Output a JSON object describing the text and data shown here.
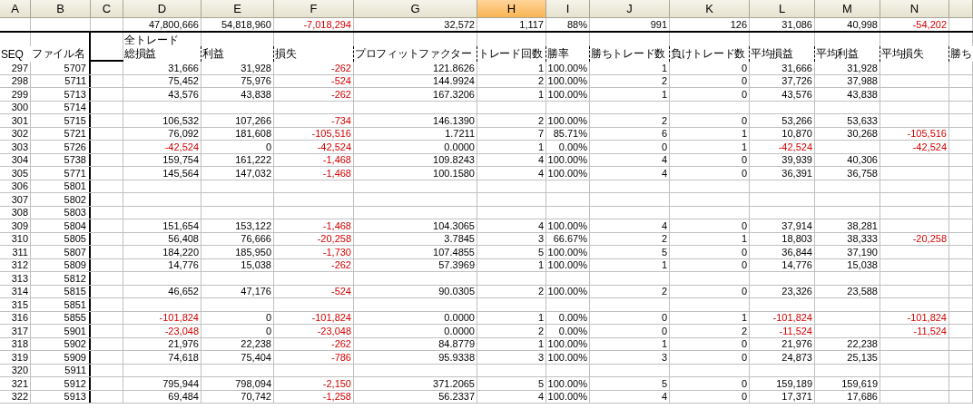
{
  "column_headers": [
    {
      "label": "A",
      "selected": false
    },
    {
      "label": "B",
      "selected": false
    },
    {
      "label": "C",
      "selected": false
    },
    {
      "label": "D",
      "selected": false
    },
    {
      "label": "E",
      "selected": false
    },
    {
      "label": "F",
      "selected": false
    },
    {
      "label": "G",
      "selected": false
    },
    {
      "label": "H",
      "selected": true
    },
    {
      "label": "I",
      "selected": false
    },
    {
      "label": "J",
      "selected": false
    },
    {
      "label": "K",
      "selected": false
    },
    {
      "label": "L",
      "selected": false
    },
    {
      "label": "M",
      "selected": false
    },
    {
      "label": "N",
      "selected": false
    }
  ],
  "totals": [
    {
      "text": "47,800,666",
      "negative": false
    },
    {
      "text": "54,818,960",
      "negative": false
    },
    {
      "text": "-7,018,294",
      "negative": true
    },
    {
      "text": "32,572",
      "negative": false
    },
    {
      "text": "1,117",
      "negative": false
    },
    {
      "text": "88%",
      "negative": false
    },
    {
      "text": "991",
      "negative": false
    },
    {
      "text": "126",
      "negative": false
    },
    {
      "text": "31,086",
      "negative": false
    },
    {
      "text": "40,998",
      "negative": false
    },
    {
      "text": "-54,202",
      "negative": true
    }
  ],
  "group_label": "全トレード",
  "key_headers": [
    "SEQ",
    "ファイル名"
  ],
  "metric_headers": [
    "総損益",
    "利益",
    "損失",
    "プロフィットファクター",
    "トレード回数",
    "勝率",
    "勝ちトレード数",
    "負けトレード数",
    "平均損益",
    "平均利益",
    "平均損失",
    "勝ち"
  ],
  "rows": [
    {
      "seq": "297",
      "file": "5707",
      "cells": [
        {
          "kind": "value",
          "text": "31,666",
          "negative": false
        },
        {
          "kind": "value",
          "text": "31,928",
          "negative": false
        },
        {
          "kind": "value",
          "text": "-262",
          "negative": true
        },
        {
          "kind": "value",
          "text": "121.8626",
          "negative": false
        },
        {
          "kind": "value",
          "text": "1",
          "negative": false
        },
        {
          "kind": "value",
          "text": "100.00%",
          "negative": false
        },
        {
          "kind": "value",
          "text": "1",
          "negative": false
        },
        {
          "kind": "value",
          "text": "0",
          "negative": false
        },
        {
          "kind": "value",
          "text": "31,666",
          "negative": false
        },
        {
          "kind": "value",
          "text": "31,928",
          "negative": false
        }
      ]
    },
    {
      "seq": "298",
      "file": "5711",
      "cells": [
        {
          "kind": "value",
          "text": "75,452",
          "negative": false
        },
        {
          "kind": "value",
          "text": "75,976",
          "negative": false
        },
        {
          "kind": "value",
          "text": "-524",
          "negative": true
        },
        {
          "kind": "value",
          "text": "144.9924",
          "negative": false
        },
        {
          "kind": "value",
          "text": "2",
          "negative": false
        },
        {
          "kind": "value",
          "text": "100.00%",
          "negative": false
        },
        {
          "kind": "value",
          "text": "2",
          "negative": false
        },
        {
          "kind": "value",
          "text": "0",
          "negative": false
        },
        {
          "kind": "value",
          "text": "37,726",
          "negative": false
        },
        {
          "kind": "value",
          "text": "37,988",
          "negative": false
        }
      ]
    },
    {
      "seq": "299",
      "file": "5713",
      "cells": [
        {
          "kind": "value",
          "text": "43,576",
          "negative": false
        },
        {
          "kind": "value",
          "text": "43,838",
          "negative": false
        },
        {
          "kind": "value",
          "text": "-262",
          "negative": true
        },
        {
          "kind": "value",
          "text": "167.3206",
          "negative": false
        },
        {
          "kind": "value",
          "text": "1",
          "negative": false
        },
        {
          "kind": "value",
          "text": "100.00%",
          "negative": false
        },
        {
          "kind": "value",
          "text": "1",
          "negative": false
        },
        {
          "kind": "value",
          "text": "0",
          "negative": false
        },
        {
          "kind": "value",
          "text": "43,576",
          "negative": false
        },
        {
          "kind": "value",
          "text": "43,838",
          "negative": false
        }
      ]
    },
    {
      "seq": "300",
      "file": "5714"
    },
    {
      "seq": "301",
      "file": "5715",
      "cells": [
        {
          "kind": "value",
          "text": "106,532",
          "negative": false
        },
        {
          "kind": "value",
          "text": "107,266",
          "negative": false
        },
        {
          "kind": "value",
          "text": "-734",
          "negative": true
        },
        {
          "kind": "value",
          "text": "146.1390",
          "negative": false
        },
        {
          "kind": "value",
          "text": "2",
          "negative": false
        },
        {
          "kind": "value",
          "text": "100.00%",
          "negative": false
        },
        {
          "kind": "value",
          "text": "2",
          "negative": false
        },
        {
          "kind": "value",
          "text": "0",
          "negative": false
        },
        {
          "kind": "value",
          "text": "53,266",
          "negative": false
        },
        {
          "kind": "value",
          "text": "53,633",
          "negative": false
        }
      ]
    },
    {
      "seq": "302",
      "file": "5721",
      "cells": [
        {
          "kind": "value",
          "text": "76,092",
          "negative": false
        },
        {
          "kind": "value",
          "text": "181,608",
          "negative": false
        },
        {
          "kind": "value",
          "text": "-105,516",
          "negative": true
        },
        {
          "kind": "value",
          "text": "1.7211",
          "negative": false
        },
        {
          "kind": "value",
          "text": "7",
          "negative": false
        },
        {
          "kind": "value",
          "text": "85.71%",
          "negative": false
        },
        {
          "kind": "value",
          "text": "6",
          "negative": false
        },
        {
          "kind": "value",
          "text": "1",
          "negative": false
        },
        {
          "kind": "value",
          "text": "10,870",
          "negative": false
        },
        {
          "kind": "value",
          "text": "30,268",
          "negative": false
        },
        {
          "kind": "value",
          "text": "-105,516",
          "negative": true
        }
      ]
    },
    {
      "seq": "303",
      "file": "5726",
      "cells": [
        {
          "kind": "value",
          "text": "-42,524",
          "negative": true
        },
        {
          "kind": "value",
          "text": "0",
          "negative": false
        },
        {
          "kind": "value",
          "text": "-42,524",
          "negative": true
        },
        {
          "kind": "value",
          "text": "0.0000",
          "negative": false
        },
        {
          "kind": "value",
          "text": "1",
          "negative": false
        },
        {
          "kind": "value",
          "text": "0.00%",
          "negative": false
        },
        {
          "kind": "value",
          "text": "0",
          "negative": false
        },
        {
          "kind": "value",
          "text": "1",
          "negative": false
        },
        {
          "kind": "value",
          "text": "-42,524",
          "negative": true
        },
        {
          "kind": "blank"
        },
        {
          "kind": "value",
          "text": "-42,524",
          "negative": true
        }
      ]
    },
    {
      "seq": "304",
      "file": "5738",
      "cells": [
        {
          "kind": "value",
          "text": "159,754",
          "negative": false
        },
        {
          "kind": "value",
          "text": "161,222",
          "negative": false
        },
        {
          "kind": "value",
          "text": "-1,468",
          "negative": true
        },
        {
          "kind": "value",
          "text": "109.8243",
          "negative": false
        },
        {
          "kind": "value",
          "text": "4",
          "negative": false
        },
        {
          "kind": "value",
          "text": "100.00%",
          "negative": false
        },
        {
          "kind": "value",
          "text": "4",
          "negative": false
        },
        {
          "kind": "value",
          "text": "0",
          "negative": false
        },
        {
          "kind": "value",
          "text": "39,939",
          "negative": false
        },
        {
          "kind": "value",
          "text": "40,306",
          "negative": false
        }
      ]
    },
    {
      "seq": "305",
      "file": "5771",
      "cells": [
        {
          "kind": "value",
          "text": "145,564",
          "negative": false
        },
        {
          "kind": "value",
          "text": "147,032",
          "negative": false
        },
        {
          "kind": "value",
          "text": "-1,468",
          "negative": true
        },
        {
          "kind": "value",
          "text": "100.1580",
          "negative": false
        },
        {
          "kind": "value",
          "text": "4",
          "negative": false
        },
        {
          "kind": "value",
          "text": "100.00%",
          "negative": false
        },
        {
          "kind": "value",
          "text": "4",
          "negative": false
        },
        {
          "kind": "value",
          "text": "0",
          "negative": false
        },
        {
          "kind": "value",
          "text": "36,391",
          "negative": false
        },
        {
          "kind": "value",
          "text": "36,758",
          "negative": false
        }
      ]
    },
    {
      "seq": "306",
      "file": "5801"
    },
    {
      "seq": "307",
      "file": "5802"
    },
    {
      "seq": "308",
      "file": "5803"
    },
    {
      "seq": "309",
      "file": "5804",
      "cells": [
        {
          "kind": "value",
          "text": "151,654",
          "negative": false
        },
        {
          "kind": "value",
          "text": "153,122",
          "negative": false
        },
        {
          "kind": "value",
          "text": "-1,468",
          "negative": true
        },
        {
          "kind": "value",
          "text": "104.3065",
          "negative": false
        },
        {
          "kind": "value",
          "text": "4",
          "negative": false
        },
        {
          "kind": "value",
          "text": "100.00%",
          "negative": false
        },
        {
          "kind": "value",
          "text": "4",
          "negative": false
        },
        {
          "kind": "value",
          "text": "0",
          "negative": false
        },
        {
          "kind": "value",
          "text": "37,914",
          "negative": false
        },
        {
          "kind": "value",
          "text": "38,281",
          "negative": false
        }
      ]
    },
    {
      "seq": "310",
      "file": "5805",
      "cells": [
        {
          "kind": "value",
          "text": "56,408",
          "negative": false
        },
        {
          "kind": "value",
          "text": "76,666",
          "negative": false
        },
        {
          "kind": "value",
          "text": "-20,258",
          "negative": true
        },
        {
          "kind": "value",
          "text": "3.7845",
          "negative": false
        },
        {
          "kind": "value",
          "text": "3",
          "negative": false
        },
        {
          "kind": "value",
          "text": "66.67%",
          "negative": false
        },
        {
          "kind": "value",
          "text": "2",
          "negative": false
        },
        {
          "kind": "value",
          "text": "1",
          "negative": false
        },
        {
          "kind": "value",
          "text": "18,803",
          "negative": false
        },
        {
          "kind": "value",
          "text": "38,333",
          "negative": false
        },
        {
          "kind": "value",
          "text": "-20,258",
          "negative": true
        }
      ]
    },
    {
      "seq": "311",
      "file": "5807",
      "cells": [
        {
          "kind": "value",
          "text": "184,220",
          "negative": false
        },
        {
          "kind": "value",
          "text": "185,950",
          "negative": false
        },
        {
          "kind": "value",
          "text": "-1,730",
          "negative": true
        },
        {
          "kind": "value",
          "text": "107.4855",
          "negative": false
        },
        {
          "kind": "value",
          "text": "5",
          "negative": false
        },
        {
          "kind": "value",
          "text": "100.00%",
          "negative": false
        },
        {
          "kind": "value",
          "text": "5",
          "negative": false
        },
        {
          "kind": "value",
          "text": "0",
          "negative": false
        },
        {
          "kind": "value",
          "text": "36,844",
          "negative": false
        },
        {
          "kind": "value",
          "text": "37,190",
          "negative": false
        }
      ]
    },
    {
      "seq": "312",
      "file": "5809",
      "cells": [
        {
          "kind": "value",
          "text": "14,776",
          "negative": false
        },
        {
          "kind": "value",
          "text": "15,038",
          "negative": false
        },
        {
          "kind": "value",
          "text": "-262",
          "negative": true
        },
        {
          "kind": "value",
          "text": "57.3969",
          "negative": false
        },
        {
          "kind": "value",
          "text": "1",
          "negative": false
        },
        {
          "kind": "value",
          "text": "100.00%",
          "negative": false
        },
        {
          "kind": "value",
          "text": "1",
          "negative": false
        },
        {
          "kind": "value",
          "text": "0",
          "negative": false
        },
        {
          "kind": "value",
          "text": "14,776",
          "negative": false
        },
        {
          "kind": "value",
          "text": "15,038",
          "negative": false
        }
      ]
    },
    {
      "seq": "313",
      "file": "5812"
    },
    {
      "seq": "314",
      "file": "5815",
      "cells": [
        {
          "kind": "value",
          "text": "46,652",
          "negative": false
        },
        {
          "kind": "value",
          "text": "47,176",
          "negative": false
        },
        {
          "kind": "value",
          "text": "-524",
          "negative": true
        },
        {
          "kind": "value",
          "text": "90.0305",
          "negative": false
        },
        {
          "kind": "value",
          "text": "2",
          "negative": false
        },
        {
          "kind": "value",
          "text": "100.00%",
          "negative": false
        },
        {
          "kind": "value",
          "text": "2",
          "negative": false
        },
        {
          "kind": "value",
          "text": "0",
          "negative": false
        },
        {
          "kind": "value",
          "text": "23,326",
          "negative": false
        },
        {
          "kind": "value",
          "text": "23,588",
          "negative": false
        }
      ]
    },
    {
      "seq": "315",
      "file": "5851"
    },
    {
      "seq": "316",
      "file": "5855",
      "cells": [
        {
          "kind": "value",
          "text": "-101,824",
          "negative": true
        },
        {
          "kind": "value",
          "text": "0",
          "negative": false
        },
        {
          "kind": "value",
          "text": "-101,824",
          "negative": true
        },
        {
          "kind": "value",
          "text": "0.0000",
          "negative": false
        },
        {
          "kind": "value",
          "text": "1",
          "negative": false
        },
        {
          "kind": "value",
          "text": "0.00%",
          "negative": false
        },
        {
          "kind": "value",
          "text": "0",
          "negative": false
        },
        {
          "kind": "value",
          "text": "1",
          "negative": false
        },
        {
          "kind": "value",
          "text": "-101,824",
          "negative": true
        },
        {
          "kind": "blank"
        },
        {
          "kind": "value",
          "text": "-101,824",
          "negative": true
        }
      ]
    },
    {
      "seq": "317",
      "file": "5901",
      "cells": [
        {
          "kind": "value",
          "text": "-23,048",
          "negative": true
        },
        {
          "kind": "value",
          "text": "0",
          "negative": false
        },
        {
          "kind": "value",
          "text": "-23,048",
          "negative": true
        },
        {
          "kind": "value",
          "text": "0.0000",
          "negative": false
        },
        {
          "kind": "value",
          "text": "2",
          "negative": false
        },
        {
          "kind": "value",
          "text": "0.00%",
          "negative": false
        },
        {
          "kind": "value",
          "text": "0",
          "negative": false
        },
        {
          "kind": "value",
          "text": "2",
          "negative": false
        },
        {
          "kind": "value",
          "text": "-11,524",
          "negative": true
        },
        {
          "kind": "blank"
        },
        {
          "kind": "value",
          "text": "-11,524",
          "negative": true
        }
      ]
    },
    {
      "seq": "318",
      "file": "5902",
      "cells": [
        {
          "kind": "value",
          "text": "21,976",
          "negative": false
        },
        {
          "kind": "value",
          "text": "22,238",
          "negative": false
        },
        {
          "kind": "value",
          "text": "-262",
          "negative": true
        },
        {
          "kind": "value",
          "text": "84.8779",
          "negative": false
        },
        {
          "kind": "value",
          "text": "1",
          "negative": false
        },
        {
          "kind": "value",
          "text": "100.00%",
          "negative": false
        },
        {
          "kind": "value",
          "text": "1",
          "negative": false
        },
        {
          "kind": "value",
          "text": "0",
          "negative": false
        },
        {
          "kind": "value",
          "text": "21,976",
          "negative": false
        },
        {
          "kind": "value",
          "text": "22,238",
          "negative": false
        }
      ]
    },
    {
      "seq": "319",
      "file": "5909",
      "cells": [
        {
          "kind": "value",
          "text": "74,618",
          "negative": false
        },
        {
          "kind": "value",
          "text": "75,404",
          "negative": false
        },
        {
          "kind": "value",
          "text": "-786",
          "negative": true
        },
        {
          "kind": "value",
          "text": "95.9338",
          "negative": false
        },
        {
          "kind": "value",
          "text": "3",
          "negative": false
        },
        {
          "kind": "value",
          "text": "100.00%",
          "negative": false
        },
        {
          "kind": "value",
          "text": "3",
          "negative": false
        },
        {
          "kind": "value",
          "text": "0",
          "negative": false
        },
        {
          "kind": "value",
          "text": "24,873",
          "negative": false
        },
        {
          "kind": "value",
          "text": "25,135",
          "negative": false
        }
      ]
    },
    {
      "seq": "320",
      "file": "5911"
    },
    {
      "seq": "321",
      "file": "5912",
      "cells": [
        {
          "kind": "value",
          "text": "795,944",
          "negative": false
        },
        {
          "kind": "value",
          "text": "798,094",
          "negative": false
        },
        {
          "kind": "value",
          "text": "-2,150",
          "negative": true
        },
        {
          "kind": "value",
          "text": "371.2065",
          "negative": false
        },
        {
          "kind": "value",
          "text": "5",
          "negative": false
        },
        {
          "kind": "value",
          "text": "100.00%",
          "negative": false
        },
        {
          "kind": "value",
          "text": "5",
          "negative": false
        },
        {
          "kind": "value",
          "text": "0",
          "negative": false
        },
        {
          "kind": "value",
          "text": "159,189",
          "negative": false
        },
        {
          "kind": "value",
          "text": "159,619",
          "negative": false
        }
      ]
    },
    {
      "seq": "322",
      "file": "5913",
      "cells": [
        {
          "kind": "value",
          "text": "69,484",
          "negative": false
        },
        {
          "kind": "value",
          "text": "70,742",
          "negative": false
        },
        {
          "kind": "value",
          "text": "-1,258",
          "negative": true
        },
        {
          "kind": "value",
          "text": "56.2337",
          "negative": false
        },
        {
          "kind": "value",
          "text": "4",
          "negative": false
        },
        {
          "kind": "value",
          "text": "100.00%",
          "negative": false
        },
        {
          "kind": "value",
          "text": "4",
          "negative": false
        },
        {
          "kind": "value",
          "text": "0",
          "negative": false
        },
        {
          "kind": "value",
          "text": "17,371",
          "negative": false
        },
        {
          "kind": "value",
          "text": "17,686",
          "negative": false
        }
      ]
    }
  ]
}
